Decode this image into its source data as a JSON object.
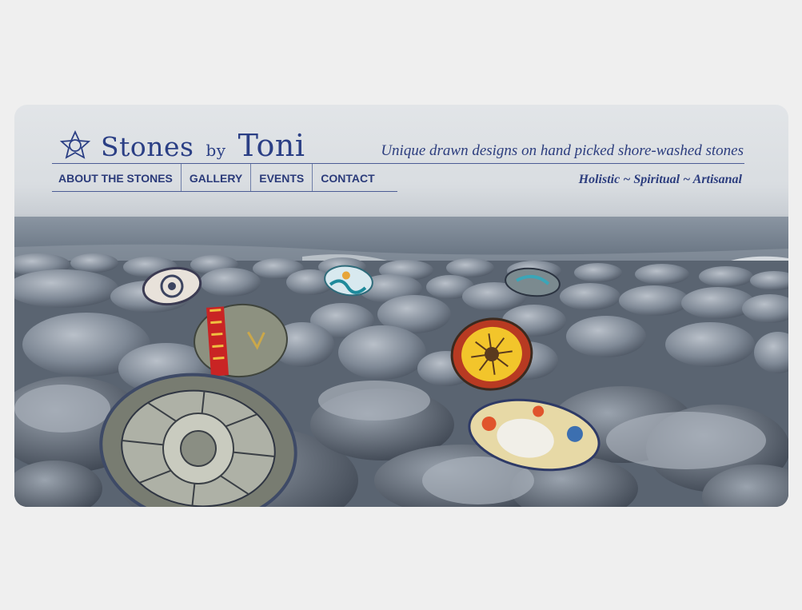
{
  "site": {
    "logo_text": "Stones",
    "logo_by": "by",
    "logo_name": "Toni",
    "tagline": "Unique drawn designs on hand picked shore-washed stones",
    "sub_tagline": "Holistic ~ Spiritual ~ Artisanal"
  },
  "nav": {
    "items": [
      {
        "label": "ABOUT THE STONES"
      },
      {
        "label": "GALLERY"
      },
      {
        "label": "EVENTS"
      },
      {
        "label": "CONTACT"
      }
    ]
  },
  "colors": {
    "page_bg": "#efefef",
    "brand_blue": "#2b3f85"
  },
  "icons": {
    "logo": "star-sun-icon"
  }
}
